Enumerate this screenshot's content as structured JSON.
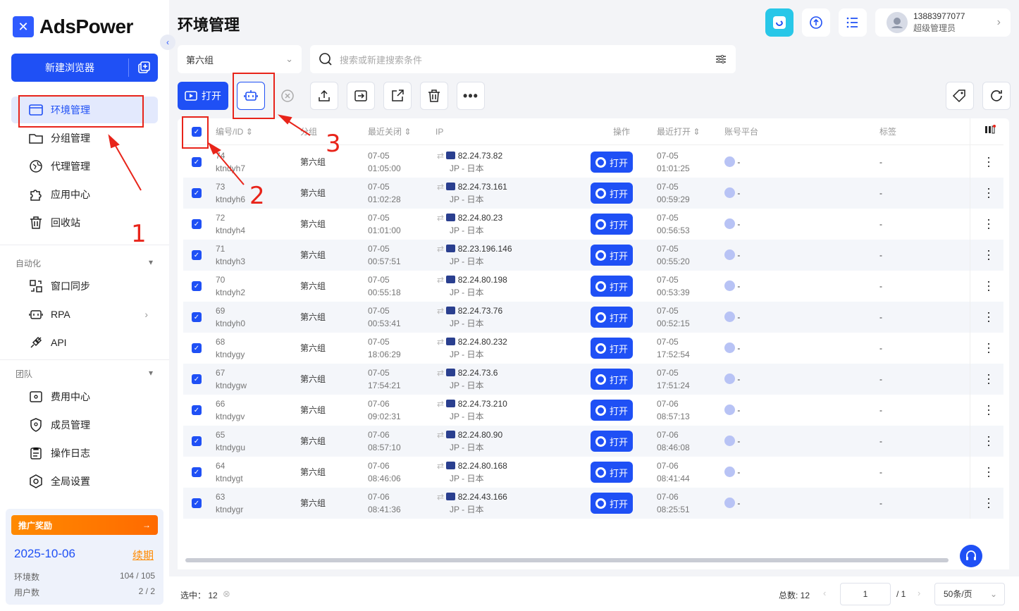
{
  "app": {
    "name": "AdsPower"
  },
  "sidebar": {
    "new_browser": "新建浏览器",
    "items": [
      {
        "label": "环境管理",
        "icon": "browser-icon"
      },
      {
        "label": "分组管理",
        "icon": "folder-icon"
      },
      {
        "label": "代理管理",
        "icon": "proxy-icon"
      },
      {
        "label": "应用中心",
        "icon": "puzzle-icon"
      },
      {
        "label": "回收站",
        "icon": "trash-icon"
      }
    ],
    "automation_title": "自动化",
    "automation_items": [
      {
        "label": "窗口同步",
        "icon": "sync-icon"
      },
      {
        "label": "RPA",
        "icon": "robot-icon"
      },
      {
        "label": "API",
        "icon": "api-icon"
      }
    ],
    "team_title": "团队",
    "team_items": [
      {
        "label": "费用中心",
        "icon": "wallet-icon"
      },
      {
        "label": "成员管理",
        "icon": "shield-icon"
      },
      {
        "label": "操作日志",
        "icon": "log-icon"
      },
      {
        "label": "全局设置",
        "icon": "settings-icon"
      }
    ],
    "promo": {
      "title": "推广奖励",
      "date": "2025-10-06",
      "renew": "续期",
      "env_label": "环境数",
      "env_value": "104 / 105",
      "user_label": "用户数",
      "user_value": "2 / 2"
    }
  },
  "header": {
    "title": "环境管理",
    "user_phone": "13883977077",
    "user_role": "超级管理员"
  },
  "filters": {
    "group": "第六组",
    "search_placeholder": "搜索或新建搜索条件"
  },
  "toolbar": {
    "open_label": "打开"
  },
  "table": {
    "columns": [
      "编号/ID",
      "分组",
      "最近关闭",
      "IP",
      "操作",
      "最近打开",
      "账号平台",
      "标签"
    ],
    "open_label": "打开",
    "rows": [
      {
        "num": "74",
        "id": "ktndyh7",
        "group": "第六组",
        "closed_date": "07-05",
        "closed_time": "01:05:00",
        "ip": "82.24.73.82",
        "loc": "JP - 日本",
        "opened_date": "07-05",
        "opened_time": "01:01:25",
        "platform": "-",
        "tag": "-"
      },
      {
        "num": "73",
        "id": "ktndyh6",
        "group": "第六组",
        "closed_date": "07-05",
        "closed_time": "01:02:28",
        "ip": "82.24.73.161",
        "loc": "JP - 日本",
        "opened_date": "07-05",
        "opened_time": "00:59:29",
        "platform": "-",
        "tag": "-"
      },
      {
        "num": "72",
        "id": "ktndyh4",
        "group": "第六组",
        "closed_date": "07-05",
        "closed_time": "01:01:00",
        "ip": "82.24.80.23",
        "loc": "JP - 日本",
        "opened_date": "07-05",
        "opened_time": "00:56:53",
        "platform": "-",
        "tag": "-"
      },
      {
        "num": "71",
        "id": "ktndyh3",
        "group": "第六组",
        "closed_date": "07-05",
        "closed_time": "00:57:51",
        "ip": "82.23.196.146",
        "loc": "JP - 日本",
        "opened_date": "07-05",
        "opened_time": "00:55:20",
        "platform": "-",
        "tag": "-"
      },
      {
        "num": "70",
        "id": "ktndyh2",
        "group": "第六组",
        "closed_date": "07-05",
        "closed_time": "00:55:18",
        "ip": "82.24.80.198",
        "loc": "JP - 日本",
        "opened_date": "07-05",
        "opened_time": "00:53:39",
        "platform": "-",
        "tag": "-"
      },
      {
        "num": "69",
        "id": "ktndyh0",
        "group": "第六组",
        "closed_date": "07-05",
        "closed_time": "00:53:41",
        "ip": "82.24.73.76",
        "loc": "JP - 日本",
        "opened_date": "07-05",
        "opened_time": "00:52:15",
        "platform": "-",
        "tag": "-"
      },
      {
        "num": "68",
        "id": "ktndygy",
        "group": "第六组",
        "closed_date": "07-05",
        "closed_time": "18:06:29",
        "ip": "82.24.80.232",
        "loc": "JP - 日本",
        "opened_date": "07-05",
        "opened_time": "17:52:54",
        "platform": "-",
        "tag": "-"
      },
      {
        "num": "67",
        "id": "ktndygw",
        "group": "第六组",
        "closed_date": "07-05",
        "closed_time": "17:54:21",
        "ip": "82.24.73.6",
        "loc": "JP - 日本",
        "opened_date": "07-05",
        "opened_time": "17:51:24",
        "platform": "-",
        "tag": "-"
      },
      {
        "num": "66",
        "id": "ktndygv",
        "group": "第六组",
        "closed_date": "07-06",
        "closed_time": "09:02:31",
        "ip": "82.24.73.210",
        "loc": "JP - 日本",
        "opened_date": "07-06",
        "opened_time": "08:57:13",
        "platform": "-",
        "tag": "-"
      },
      {
        "num": "65",
        "id": "ktndygu",
        "group": "第六组",
        "closed_date": "07-06",
        "closed_time": "08:57:10",
        "ip": "82.24.80.90",
        "loc": "JP - 日本",
        "opened_date": "07-06",
        "opened_time": "08:46:08",
        "platform": "-",
        "tag": "-"
      },
      {
        "num": "64",
        "id": "ktndygt",
        "group": "第六组",
        "closed_date": "07-06",
        "closed_time": "08:46:06",
        "ip": "82.24.80.168",
        "loc": "JP - 日本",
        "opened_date": "07-06",
        "opened_time": "08:41:44",
        "platform": "-",
        "tag": "-"
      },
      {
        "num": "63",
        "id": "ktndygr",
        "group": "第六组",
        "closed_date": "07-06",
        "closed_time": "08:41:36",
        "ip": "82.24.43.166",
        "loc": "JP - 日本",
        "opened_date": "07-06",
        "opened_time": "08:25:51",
        "platform": "-",
        "tag": "-"
      }
    ]
  },
  "footer": {
    "selected_label": "选中：",
    "selected_count": "12",
    "total_label": "总数: 12",
    "page_input": "1",
    "page_total": "/ 1",
    "page_size": "50条/页"
  },
  "annotations": [
    "1",
    "2",
    "3"
  ],
  "colors": {
    "accent": "#1f50f5",
    "annotation": "#e8241a",
    "promo": "#ff8a00"
  }
}
